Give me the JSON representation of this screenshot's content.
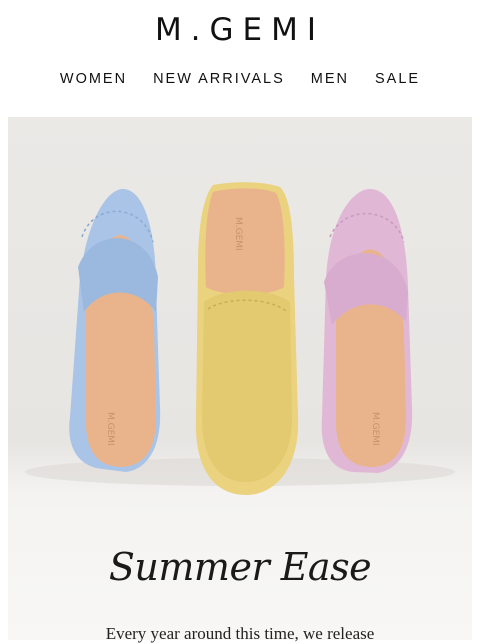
{
  "brand": {
    "logo": "M.GEMI"
  },
  "nav": {
    "items": [
      "WOMEN",
      "NEW ARRIVALS",
      "MEN",
      "SALE"
    ]
  },
  "hero": {
    "image_alt": "three suede mules in blue, yellow and pink",
    "shoe_stamp": "M.GEMI",
    "colors": {
      "blue": "#a9c4e6",
      "yellow": "#ead27e",
      "pink": "#e0b8d6",
      "lining": "#e9b48c"
    }
  },
  "content": {
    "headline": "Summer Ease",
    "body": "Every year around this time, we release"
  }
}
